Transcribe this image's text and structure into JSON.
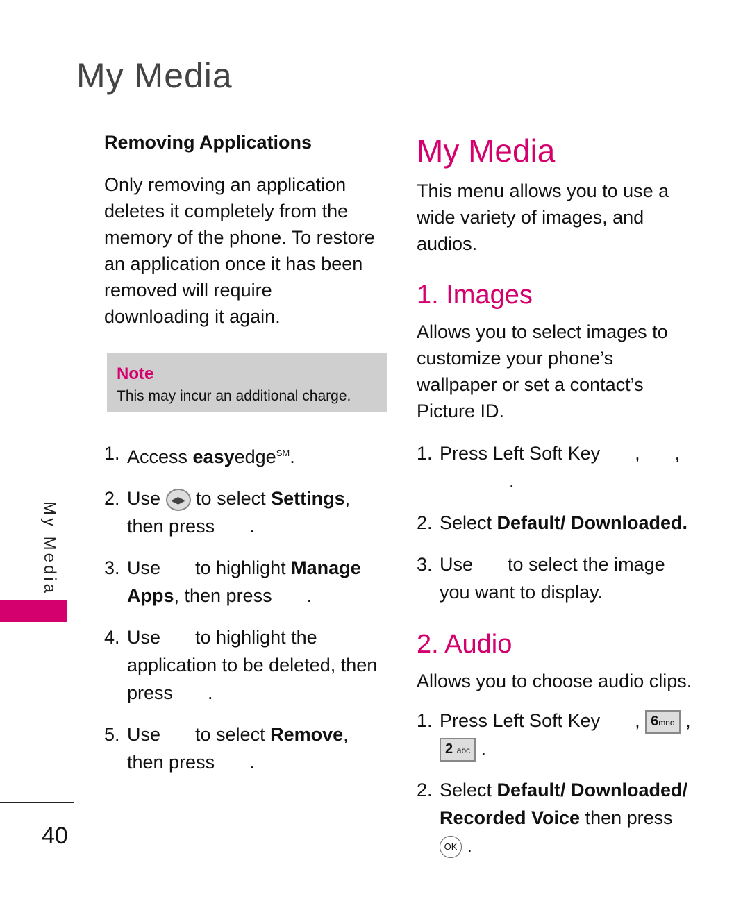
{
  "header": {
    "title": "My Media"
  },
  "side": {
    "label": "My Media",
    "page_number": "40"
  },
  "left": {
    "subtitle": "Removing Applications",
    "intro": "Only removing an application deletes it completely from the memory of the phone. To restore an application once it has been removed will require downloading it again.",
    "note": {
      "title": "Note",
      "text": "This may incur an additional charge."
    },
    "steps": [
      {
        "num": "1.",
        "a": "Access ",
        "brand_bold": "easy",
        "brand_rest": "edge",
        "sup": "SM",
        "end": "."
      },
      {
        "num": "2.",
        "a": "Use",
        "b": "to select ",
        "bold": "Settings",
        "c": ", then press",
        "end": "."
      },
      {
        "num": "3.",
        "a": "Use",
        "b": "to highlight ",
        "bold": "Manage Apps",
        "c": ", then press",
        "end": "."
      },
      {
        "num": "4.",
        "a": "Use",
        "b": "to highlight the application to be deleted, then press",
        "end": "."
      },
      {
        "num": "5.",
        "a": "Use",
        "b": "to select ",
        "bold": "Remove",
        "c": ", then press",
        "end": "."
      }
    ]
  },
  "right": {
    "title": "My Media",
    "intro": "This menu allows you to use a wide variety of images, and audios.",
    "images": {
      "heading": "1. Images",
      "desc": "Allows you to select images to customize your phone’s wallpaper or set a contact’s Picture ID.",
      "steps": [
        {
          "num": "1.",
          "text": "Press Left Soft Key",
          "sep": ",",
          "sep2": ",",
          "end": "."
        },
        {
          "num": "2.",
          "a": "Select ",
          "bold": "Default/ Downloaded."
        },
        {
          "num": "3.",
          "a": "Use",
          "b": "to select the image you want to display."
        }
      ]
    },
    "audio": {
      "heading": "2. Audio",
      "desc": "Allows you to choose audio clips.",
      "steps": [
        {
          "num": "1.",
          "text": "Press Left Soft Key",
          "key1": "6",
          "key1_sub": "mno",
          "key2": "2",
          "key2_sub": "abc"
        },
        {
          "num": "2.",
          "a": "Select ",
          "bold": "Default/ Downloaded/ Recorded Voice",
          "c": " then press",
          "ok": "OK"
        }
      ]
    }
  },
  "colors": {
    "accent": "#d4006d",
    "note_bg": "#cfcfcf"
  }
}
